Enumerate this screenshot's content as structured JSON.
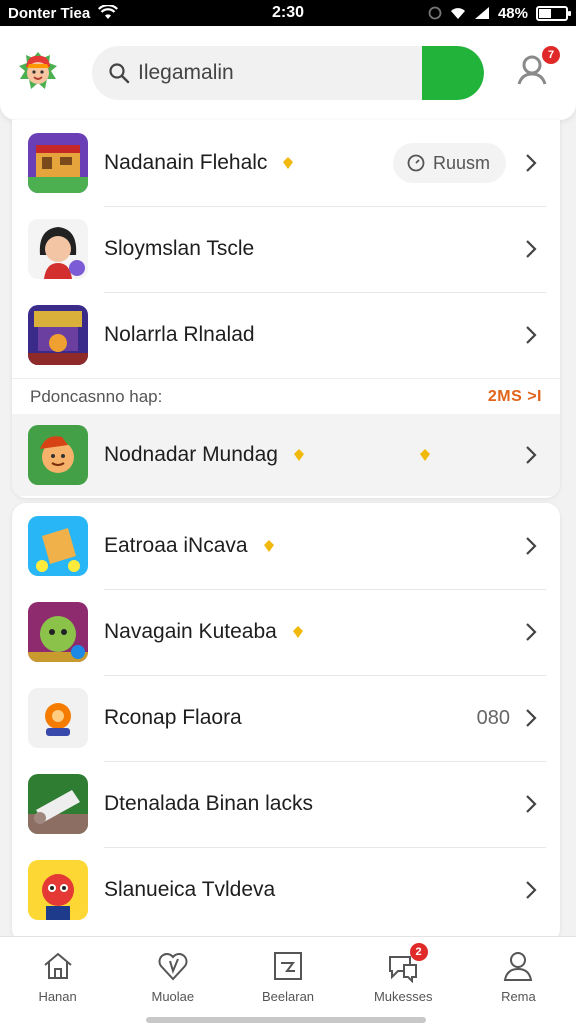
{
  "status_bar": {
    "carrier": "Donter Tiea",
    "time": "2:30",
    "battery_percent": "48%",
    "battery_level": 0.48
  },
  "header": {
    "search_value": "Ilegamalin",
    "notification_count": "7"
  },
  "card1": {
    "rows": [
      {
        "title": "Nadanain Flehalc",
        "pill_label": "Ruusm"
      },
      {
        "title": "Sloymslan Tscle"
      },
      {
        "title": "Nolarrla Rlnalad"
      }
    ],
    "section": {
      "label": "Pdoncasnno hap:",
      "link": "2MS >I"
    },
    "active_row": {
      "title": "Nodnadar Mundag"
    }
  },
  "card2": {
    "rows": [
      {
        "title": "Eatroaa iNcava"
      },
      {
        "title": "Navagain Kuteaba"
      },
      {
        "title": "Rconap Flaora",
        "trailing": "080"
      },
      {
        "title": "Dtenalada Binan lacks"
      },
      {
        "title": "Slanueica Tvldeva"
      }
    ]
  },
  "tabbar": {
    "tabs": [
      {
        "label": "Hanan",
        "icon": "home-icon"
      },
      {
        "label": "Muolae",
        "icon": "heart-icon"
      },
      {
        "label": "Beelaran",
        "icon": "media-icon"
      },
      {
        "label": "Mukesses",
        "icon": "messages-icon",
        "badge": "2"
      },
      {
        "label": "Rema",
        "icon": "profile-icon"
      }
    ]
  },
  "colors": {
    "accent_green": "#22b33a",
    "badge_red": "#e02a2a",
    "link_orange": "#e0651b",
    "dot_yellow": "#f0b90b"
  }
}
